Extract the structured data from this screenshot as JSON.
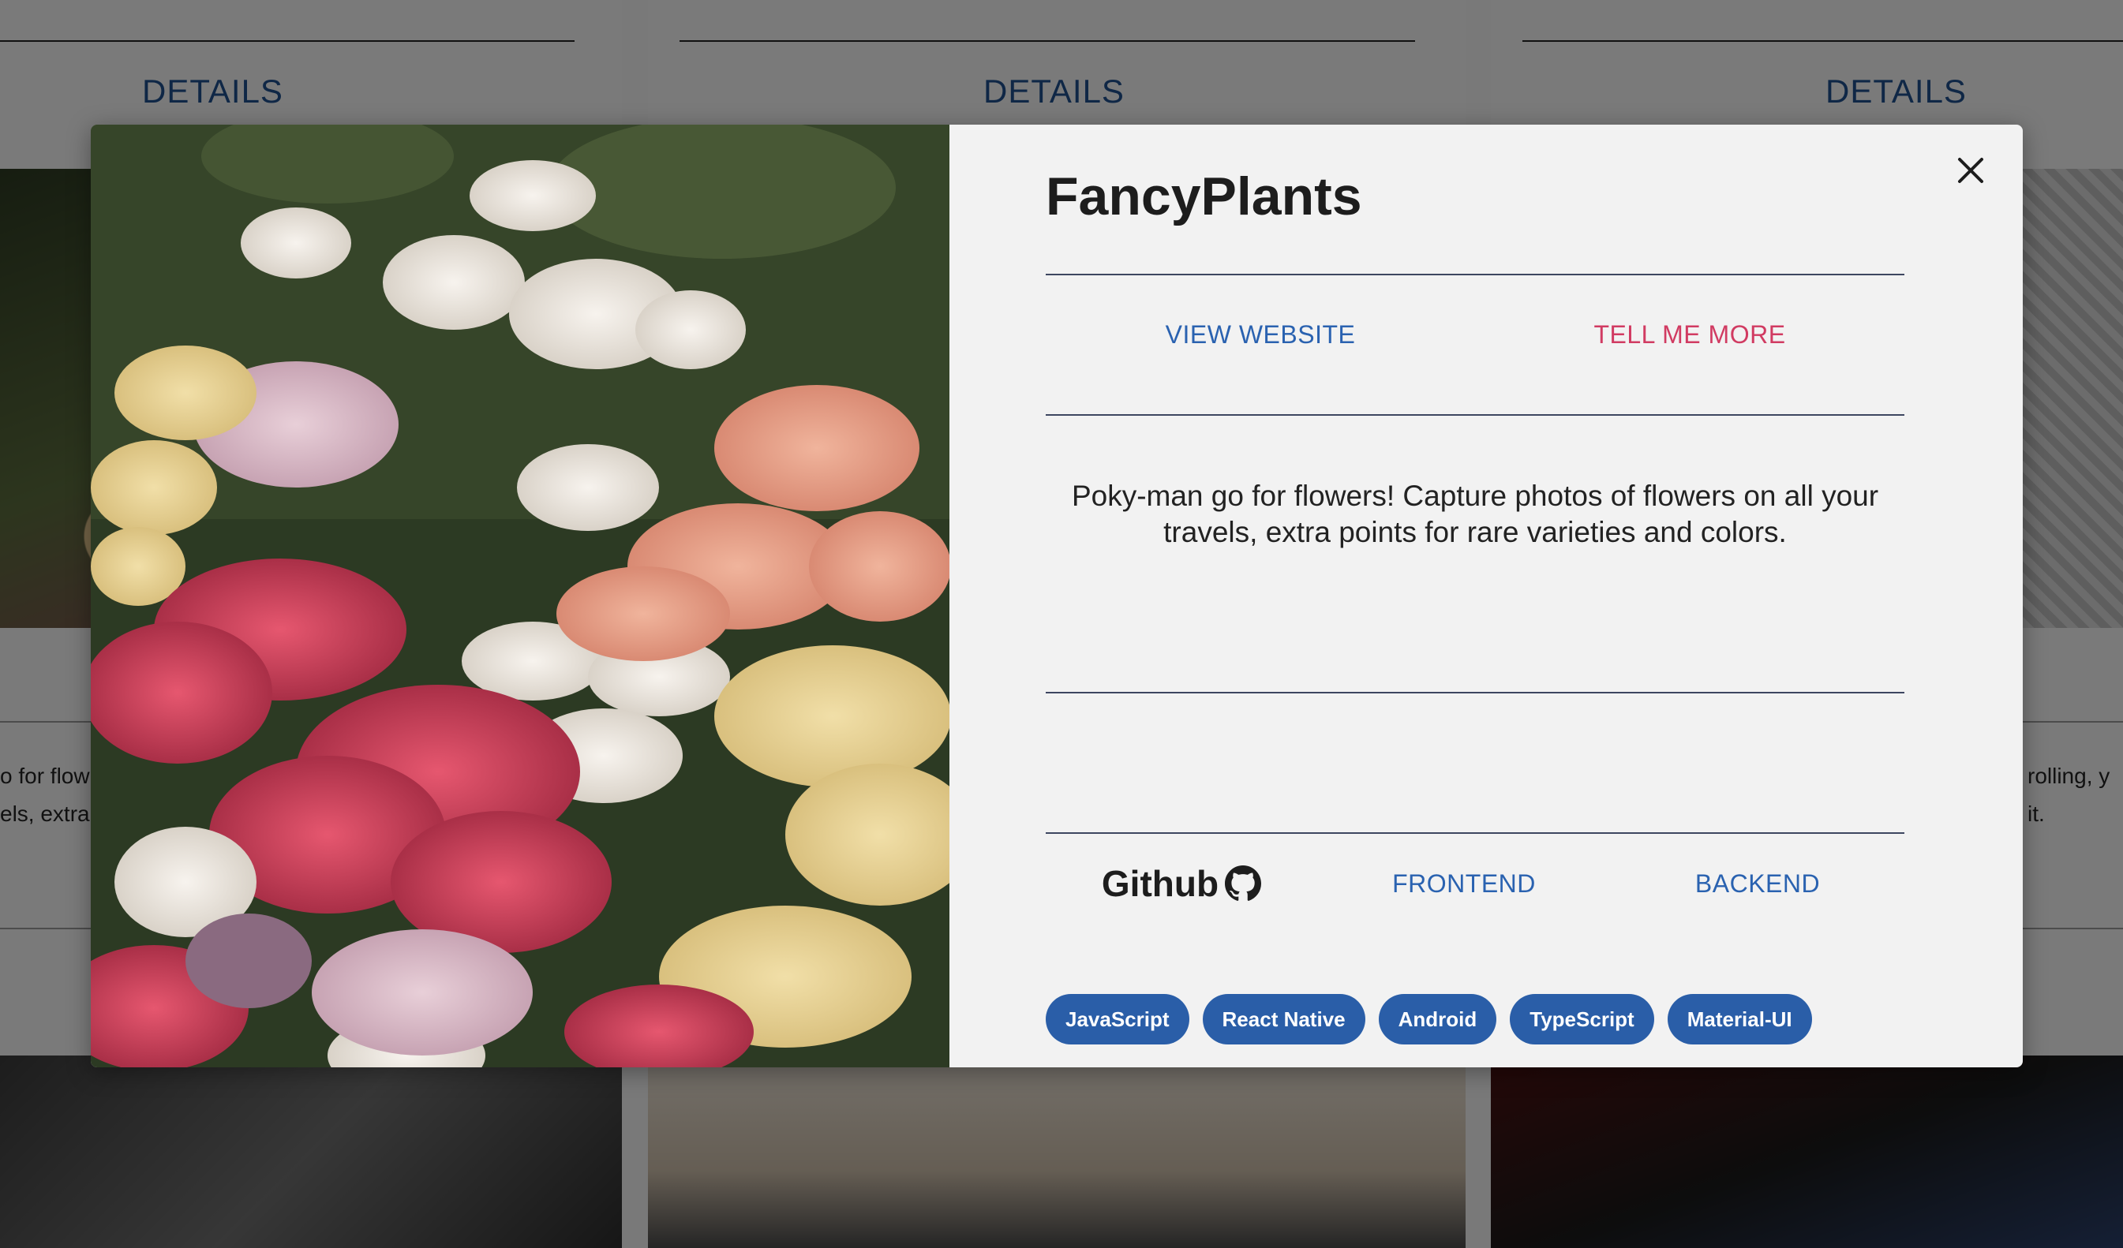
{
  "background": {
    "details_labels": [
      "DETAILS",
      "DETAILS",
      "DETAILS"
    ],
    "text_fragments": [
      "o for flow",
      "els, extra",
      "rolling, y",
      "it."
    ]
  },
  "modal": {
    "title": "FancyPlants",
    "close_icon": "close-icon",
    "links": {
      "view_website": "VIEW WEBSITE",
      "tell_me_more": "TELL ME MORE"
    },
    "description": "Poky-man go for flowers! Capture photos of flowers on all your travels, extra points for rare varieties and colors.",
    "github": {
      "label": "Github",
      "icon": "github-icon",
      "frontend": "FRONTEND",
      "backend": "BACKEND"
    },
    "tags": [
      "JavaScript",
      "React Native",
      "Android",
      "TypeScript",
      "Material-UI"
    ]
  },
  "colors": {
    "link_blue": "#2a62b0",
    "link_red": "#d13b62",
    "chip_blue": "#2a5ea8",
    "overlay": "rgba(0,0,0,0.5)"
  }
}
